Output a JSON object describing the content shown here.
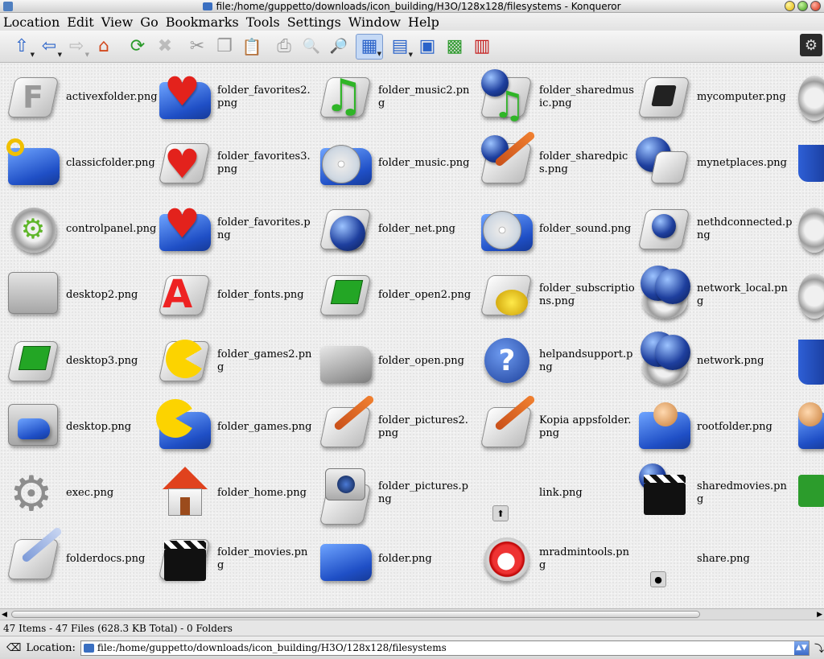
{
  "window": {
    "title": "file:/home/guppetto/downloads/icon_building/H3O/128x128/filesystems - Konqueror"
  },
  "menu": [
    "Location",
    "Edit",
    "View",
    "Go",
    "Bookmarks",
    "Tools",
    "Settings",
    "Window",
    "Help"
  ],
  "toolbar": {
    "buttons": [
      {
        "name": "up-icon",
        "glyph": "⇧"
      },
      {
        "name": "back-icon",
        "glyph": "⇦"
      },
      {
        "name": "forward-icon",
        "glyph": "⇨"
      },
      {
        "name": "home-icon",
        "glyph": "⌂"
      },
      {
        "name": "reload-icon",
        "glyph": "⟳"
      },
      {
        "name": "stop-icon",
        "glyph": "✖"
      },
      {
        "name": "cut-icon",
        "glyph": "✂"
      },
      {
        "name": "copy-icon",
        "glyph": "❐"
      },
      {
        "name": "paste-icon",
        "glyph": "📋"
      },
      {
        "name": "print-icon",
        "glyph": "⎙"
      },
      {
        "name": "zoom-out-icon",
        "glyph": "🔍"
      },
      {
        "name": "zoom-in-icon",
        "glyph": "🔎"
      },
      {
        "name": "icon-view-icon",
        "glyph": "▦"
      },
      {
        "name": "detail-view-icon",
        "glyph": "▤"
      },
      {
        "name": "preview-icon",
        "glyph": "▣"
      },
      {
        "name": "thumbnail-icon",
        "glyph": "▩"
      },
      {
        "name": "split-view-icon",
        "glyph": "▥"
      }
    ]
  },
  "files": [
    {
      "label": "activexfolder.png",
      "icon": "activex-icon"
    },
    {
      "label": "classicfolder.png",
      "icon": "classic-folder-icon"
    },
    {
      "label": "controlpanel.png",
      "icon": "control-panel-icon"
    },
    {
      "label": "desktop2.png",
      "icon": "desktop-icon"
    },
    {
      "label": "desktop3.png",
      "icon": "desktop-icon"
    },
    {
      "label": "desktop.png",
      "icon": "desktop-icon"
    },
    {
      "label": "exec.png",
      "icon": "gear-icon"
    },
    {
      "label": "folderdocs.png",
      "icon": "documents-icon"
    },
    {
      "label": "folder_favorites2.png",
      "icon": "heart-folder-icon"
    },
    {
      "label": "folder_favorites3.png",
      "icon": "heart-icon"
    },
    {
      "label": "folder_favorites.png",
      "icon": "heart-folder-icon"
    },
    {
      "label": "folder_fonts.png",
      "icon": "fonts-icon"
    },
    {
      "label": "folder_games2.png",
      "icon": "pacman-icon"
    },
    {
      "label": "folder_games.png",
      "icon": "pacman-folder-icon"
    },
    {
      "label": "folder_home.png",
      "icon": "home-icon"
    },
    {
      "label": "folder_movies.png",
      "icon": "clapper-icon"
    },
    {
      "label": "folder_music2.png",
      "icon": "music-note-icon"
    },
    {
      "label": "folder_music.png",
      "icon": "cd-folder-icon"
    },
    {
      "label": "folder_net.png",
      "icon": "globe-icon"
    },
    {
      "label": "folder_open2.png",
      "icon": "open-folder-icon"
    },
    {
      "label": "folder_open.png",
      "icon": "grey-folder-icon"
    },
    {
      "label": "folder_pictures2.png",
      "icon": "brush-icon"
    },
    {
      "label": "folder_pictures.png",
      "icon": "camera-icon"
    },
    {
      "label": "folder.png",
      "icon": "folder-icon"
    },
    {
      "label": "folder_sharedmusic.png",
      "icon": "globe-music-icon"
    },
    {
      "label": "folder_sharedpics.png",
      "icon": "globe-brush-icon"
    },
    {
      "label": "folder_sound.png",
      "icon": "cd-folder-icon"
    },
    {
      "label": "folder_subscriptions.png",
      "icon": "coins-icon"
    },
    {
      "label": "helpandsupport.png",
      "icon": "help-icon"
    },
    {
      "label": "Kopia appsfolder.png",
      "icon": "brush-icon"
    },
    {
      "label": "link.png",
      "icon": "link-icon"
    },
    {
      "label": "mradmintools.png",
      "icon": "admin-icon"
    },
    {
      "label": "mycomputer.png",
      "icon": "computer-icon"
    },
    {
      "label": "mynetplaces.png",
      "icon": "network-places-icon"
    },
    {
      "label": "nethdconnected.png",
      "icon": "net-drive-icon"
    },
    {
      "label": "network_local.png",
      "icon": "network-icon"
    },
    {
      "label": "network.png",
      "icon": "network-icon"
    },
    {
      "label": "rootfolder.png",
      "icon": "user-folder-icon"
    },
    {
      "label": "sharedmovies.png",
      "icon": "globe-clapper-icon"
    },
    {
      "label": "share.png",
      "icon": "share-icon"
    }
  ],
  "status": "47 Items - 47 Files (628.3 KB Total) - 0 Folders",
  "location": {
    "label": "Location:",
    "value": "file:/home/guppetto/downloads/icon_building/H3O/128x128/filesystems"
  }
}
